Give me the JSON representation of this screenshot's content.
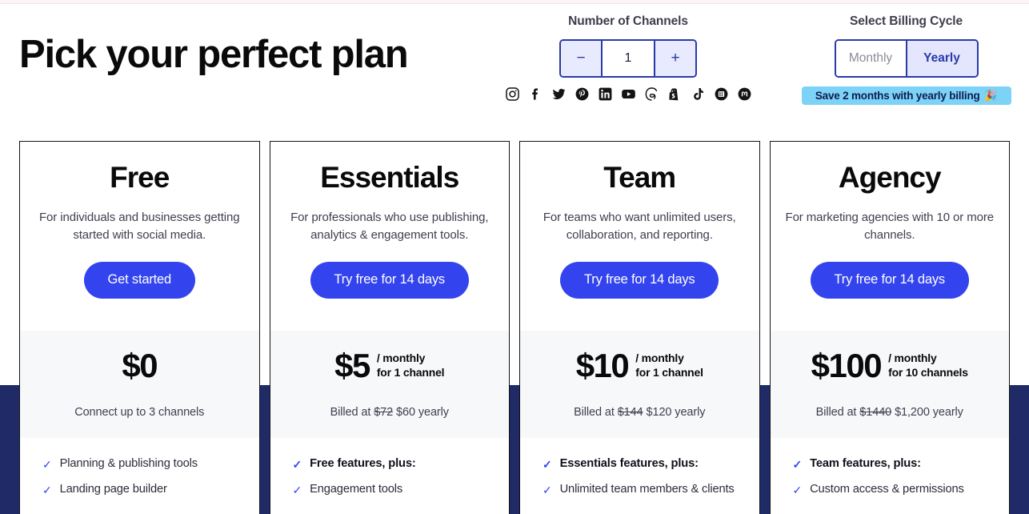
{
  "header": {
    "headline": "Pick your perfect plan",
    "channels": {
      "label": "Number of Channels",
      "decrement": "−",
      "value": "1",
      "increment": "+",
      "social_icons": [
        "instagram-icon",
        "facebook-icon",
        "twitter-icon",
        "pinterest-icon",
        "linkedin-icon",
        "youtube-icon",
        "threads-icon",
        "shopify-icon",
        "tiktok-icon",
        "google-business-icon",
        "mastodon-icon"
      ]
    },
    "billing": {
      "label": "Select Billing Cycle",
      "monthly": "Monthly",
      "yearly": "Yearly",
      "selected": "Yearly",
      "save_badge": "Save 2 months with yearly billing",
      "save_badge_emoji": "🎉"
    }
  },
  "colors": {
    "accent_blue": "#3344ee",
    "border_blue": "#2a3aa8",
    "navy_band": "#1f2a66",
    "badge_cyan": "#7cd3f7",
    "price_bg": "#f7f8fa"
  },
  "plans": [
    {
      "name": "Free",
      "description": "For individuals and businesses getting started with social media.",
      "cta": "Get started",
      "price": "$0",
      "price_unit_line1": "",
      "price_unit_line2": "",
      "billed_prefix": "Connect up to 3 channels",
      "billed_strike": "",
      "billed_suffix": "",
      "features": [
        {
          "text": "Planning & publishing tools",
          "bold": false
        },
        {
          "text": "Landing page builder",
          "bold": false
        }
      ]
    },
    {
      "name": "Essentials",
      "description": "For professionals who use publishing, analytics & engagement tools.",
      "cta": "Try free for 14 days",
      "price": "$5",
      "price_unit_line1": "/ monthly",
      "price_unit_line2": "for 1 channel",
      "billed_prefix": "Billed at",
      "billed_strike": "$72",
      "billed_suffix": "$60 yearly",
      "features": [
        {
          "text": "Free features, plus:",
          "bold": true
        },
        {
          "text": "Engagement tools",
          "bold": false
        }
      ]
    },
    {
      "name": "Team",
      "description": "For teams who want unlimited users, collaboration, and reporting.",
      "cta": "Try free for 14 days",
      "price": "$10",
      "price_unit_line1": "/ monthly",
      "price_unit_line2": "for 1 channel",
      "billed_prefix": "Billed at",
      "billed_strike": "$144",
      "billed_suffix": "$120 yearly",
      "features": [
        {
          "text": "Essentials features, plus:",
          "bold": true
        },
        {
          "text": "Unlimited team members & clients",
          "bold": false
        }
      ]
    },
    {
      "name": "Agency",
      "description": "For marketing agencies with 10 or more channels.",
      "cta": "Try free for 14 days",
      "price": "$100",
      "price_unit_line1": "/ monthly",
      "price_unit_line2": "for 10 channels",
      "billed_prefix": "Billed at",
      "billed_strike": "$1440",
      "billed_suffix": "$1,200 yearly",
      "features": [
        {
          "text": "Team features, plus:",
          "bold": true
        },
        {
          "text": "Custom access & permissions",
          "bold": false
        }
      ]
    }
  ]
}
